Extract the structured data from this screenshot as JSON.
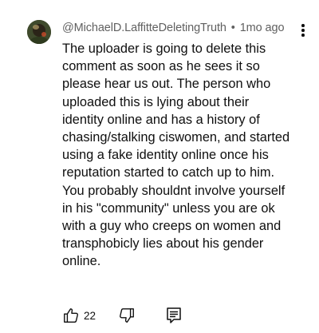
{
  "comment": {
    "author": "@MichaelD.LaffitteDeletingTruth",
    "separator": "•",
    "timestamp": "1mo ago",
    "text_lines": [
      "The uploader is going to delete this",
      "comment as soon as he sees it so",
      "please hear us out. The person who",
      "uploaded this is lying about their",
      "identity online and has a history of",
      "chasing/stalking ciswomen, and started",
      "using a fake identity online once his",
      "reputation started to catch up to him.",
      "You probably shouldnt involve yourself",
      "in his \"community\" unless you are ok",
      "with a guy who creeps on women and",
      "transphobicly lies about his gender",
      "online."
    ],
    "like_count": "22"
  },
  "icons": {
    "avatar": "avatar",
    "menu": "more-vert-icon",
    "like": "thumbs-up-icon",
    "dislike": "thumbs-down-icon",
    "reply": "reply-comment-icon"
  },
  "colors": {
    "text": "#0f0f0f",
    "meta": "#606060",
    "background": "#ffffff"
  }
}
